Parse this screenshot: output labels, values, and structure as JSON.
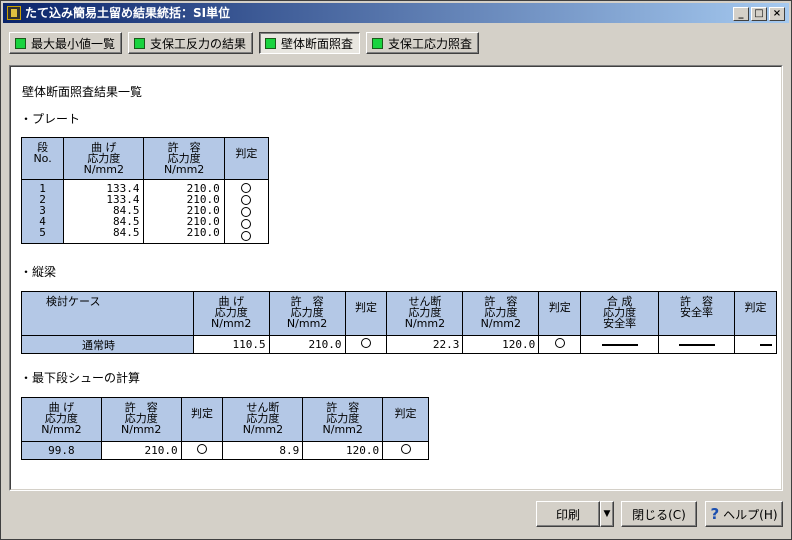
{
  "window": {
    "title": "たて込み簡易土留め結果統括：SI単位",
    "min": "_",
    "max": "□",
    "close": "×"
  },
  "tabs": [
    "最大最小値一覧",
    "支保工反力の結果",
    "壁体断面照査",
    "支保工応力照査"
  ],
  "heading": "壁体断面照査結果一覧",
  "plate": {
    "label": "・プレート",
    "headers": {
      "dan": [
        "段",
        "No."
      ],
      "mage": [
        "曲 げ",
        "応力度",
        "N/mm2"
      ],
      "kyoyo": [
        "許　容",
        "応力度",
        "N/mm2"
      ],
      "hantei": "判定"
    },
    "rows": [
      {
        "no": "1",
        "mage": "133.4",
        "kyoyo": "210.0"
      },
      {
        "no": "2",
        "mage": "133.4",
        "kyoyo": "210.0"
      },
      {
        "no": "3",
        "mage": "84.5",
        "kyoyo": "210.0"
      },
      {
        "no": "4",
        "mage": "84.5",
        "kyoyo": "210.0"
      },
      {
        "no": "5",
        "mage": "84.5",
        "kyoyo": "210.0"
      }
    ]
  },
  "beam": {
    "label": "・縦梁",
    "headers": {
      "case": "検討ケース",
      "mage": [
        "曲 げ",
        "応力度",
        "N/mm2"
      ],
      "kyoyo1": [
        "許　容",
        "応力度",
        "N/mm2"
      ],
      "hantei1": "判定",
      "sendan": [
        "せん断",
        "応力度",
        "N/mm2"
      ],
      "kyoyo2": [
        "許　容",
        "応力度",
        "N/mm2"
      ],
      "hantei2": "判定",
      "gosei": [
        "合 成",
        "応力度",
        "安全率"
      ],
      "kyoyo3": [
        "許　容",
        "安全率"
      ],
      "hantei3": "判定"
    },
    "row": {
      "case": "通常時",
      "mage": "110.5",
      "kyoyo1": "210.0",
      "sendan": "22.3",
      "kyoyo2": "120.0"
    }
  },
  "shoe": {
    "label": "・最下段シューの計算",
    "headers": {
      "mage": [
        "曲 げ",
        "応力度",
        "N/mm2"
      ],
      "kyoyo1": [
        "許　容",
        "応力度",
        "N/mm2"
      ],
      "hantei1": "判定",
      "sendan": [
        "せん断",
        "応力度",
        "N/mm2"
      ],
      "kyoyo2": [
        "許　容",
        "応力度",
        "N/mm2"
      ],
      "hantei2": "判定"
    },
    "row": {
      "mage": "99.8",
      "kyoyo1": "210.0",
      "sendan": "8.9",
      "kyoyo2": "120.0"
    }
  },
  "buttons": {
    "print": "印刷",
    "dropdown": "▼",
    "close": "閉じる(C)",
    "help": "ヘルプ(H)"
  }
}
